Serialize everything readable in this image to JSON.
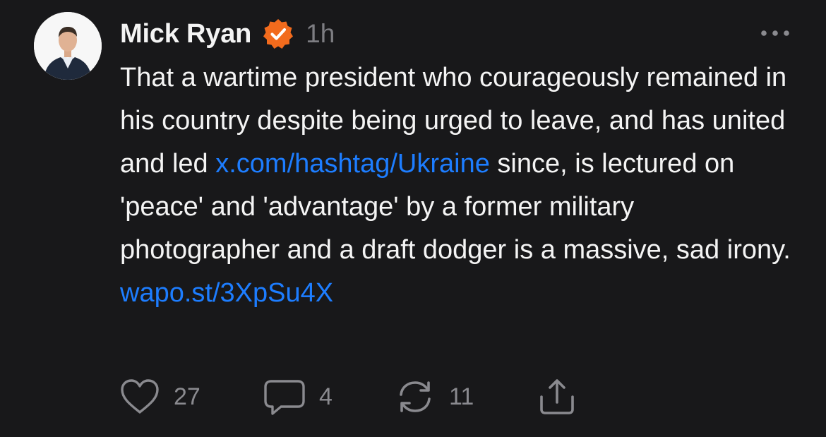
{
  "author": {
    "name": "Mick Ryan",
    "verified": true,
    "time": "1h"
  },
  "post": {
    "text_1": "That a wartime president who courageously remained in his country despite being urged to leave, and has united and led ",
    "link_1": "x.com/hashtag/Ukraine",
    "text_2": " since, is lectured on 'peace' and 'advantage' by a former military photographer and a draft dodger is a massive, sad irony.",
    "link_2": "wapo.st/3XpSu4X"
  },
  "actions": {
    "likes": "27",
    "replies": "4",
    "reposts": "11"
  },
  "colors": {
    "background": "#18181a",
    "link": "#1d7dff",
    "verified": "#f26b1d",
    "muted": "#8a8a8f"
  },
  "icons": [
    "more-options-icon",
    "verified-badge-icon",
    "heart-icon",
    "comment-icon",
    "repost-icon",
    "share-icon"
  ]
}
